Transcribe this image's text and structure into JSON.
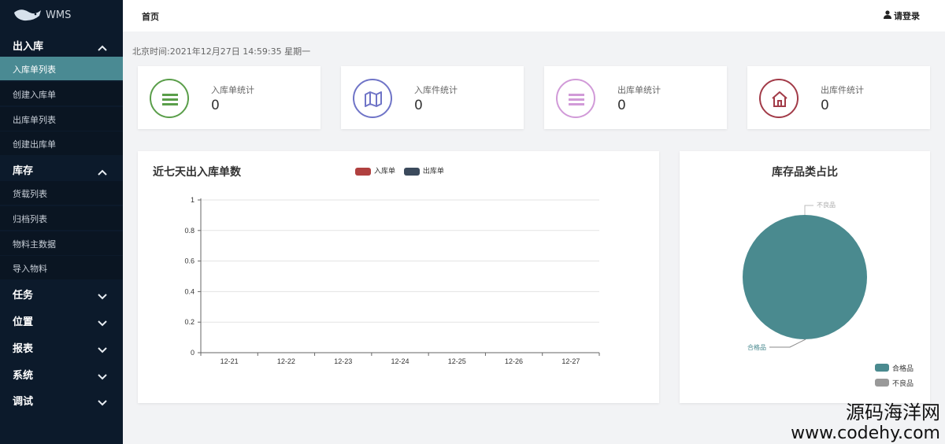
{
  "app": {
    "name": "WMS"
  },
  "sidebar": {
    "groups": [
      {
        "label": "出入库",
        "expanded": true,
        "items": [
          "入库单列表",
          "创建入库单",
          "出库单列表",
          "创建出库单"
        ]
      },
      {
        "label": "库存",
        "expanded": true,
        "items": [
          "货载列表",
          "归档列表",
          "物料主数据",
          "导入物料"
        ]
      },
      {
        "label": "任务",
        "expanded": false
      },
      {
        "label": "位置",
        "expanded": false
      },
      {
        "label": "报表",
        "expanded": false
      },
      {
        "label": "系统",
        "expanded": false
      },
      {
        "label": "调试",
        "expanded": false
      }
    ],
    "active_item": "入库单列表"
  },
  "topbar": {
    "home": "首页",
    "login": "请登录"
  },
  "time": "北京时间:2021年12月27日 14:59:35 星期一",
  "stats": [
    {
      "title": "入库单统计",
      "value": "0",
      "icon": "list-icon",
      "color": "#5a9e4a"
    },
    {
      "title": "入库件统计",
      "value": "0",
      "icon": "map-icon",
      "color": "#6f74c7"
    },
    {
      "title": "出库单统计",
      "value": "0",
      "icon": "list-icon",
      "color": "#d19ad8"
    },
    {
      "title": "出库件统计",
      "value": "0",
      "icon": "house-icon",
      "color": "#a23b48"
    }
  ],
  "chart_data": [
    {
      "type": "bar",
      "title": "近七天出入库单数",
      "categories": [
        "12-21",
        "12-22",
        "12-23",
        "12-24",
        "12-25",
        "12-26",
        "12-27"
      ],
      "series": [
        {
          "name": "入库单",
          "values": [
            0,
            0,
            0,
            0,
            0,
            0,
            0
          ],
          "color": "#b0403f"
        },
        {
          "name": "出库单",
          "values": [
            0,
            0,
            0,
            0,
            0,
            0,
            0
          ],
          "color": "#3b4a5c"
        }
      ],
      "ylim": [
        0,
        1
      ],
      "yticks": [
        "0",
        "0.2",
        "0.4",
        "0.6",
        "0.8",
        "1"
      ],
      "grid": true,
      "legend": "top"
    },
    {
      "type": "pie",
      "title": "库存品类占比",
      "categories": [
        "合格品",
        "不良品"
      ],
      "values": [
        100,
        0
      ],
      "colors": [
        "#4a8a8f",
        "#999999"
      ],
      "legend": "bottom-right"
    }
  ],
  "watermark": {
    "line1": "源码海洋网",
    "line2": "www.codehy.com"
  }
}
